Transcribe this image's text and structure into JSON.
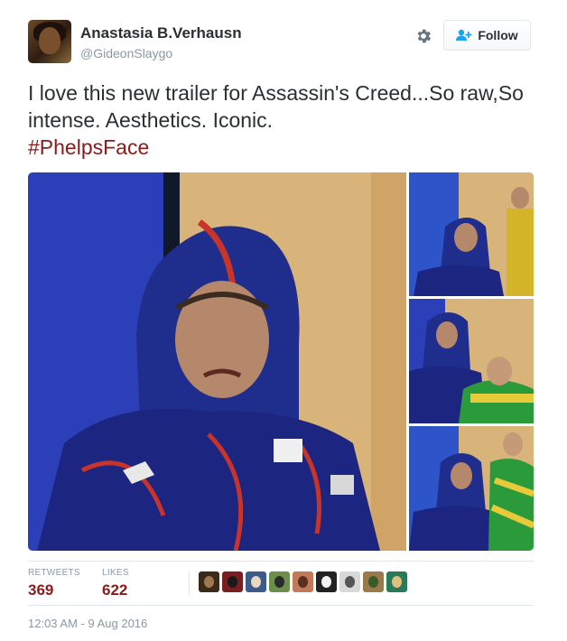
{
  "user": {
    "name": "Anastasia B.Verhausn",
    "handle": "@GideonSlaygo",
    "avatar_icon": "profile-avatar"
  },
  "actions": {
    "settings_icon": "gear-icon",
    "follow_icon": "add-user-icon",
    "follow_label": "Follow"
  },
  "tweet": {
    "text": "I love this new trailer for Assassin's Creed...So raw,So intense. Aesthetics. Iconic.",
    "hashtag": "#PhelpsFace"
  },
  "media": {
    "photos": [
      {
        "name": "main-photo"
      },
      {
        "name": "thumbnail-1"
      },
      {
        "name": "thumbnail-2"
      },
      {
        "name": "thumbnail-3"
      }
    ]
  },
  "stats": {
    "retweets_label": "RETWEETS",
    "retweets_value": "369",
    "likes_label": "LIKES",
    "likes_value": "622"
  },
  "likers": {
    "count_shown": 9
  },
  "timestamp": "12:03 AM - 9 Aug 2016",
  "colors": {
    "accent": "#8b1a1a",
    "muted": "#8899a6",
    "text": "#292f33",
    "border": "#e1e8ed"
  }
}
